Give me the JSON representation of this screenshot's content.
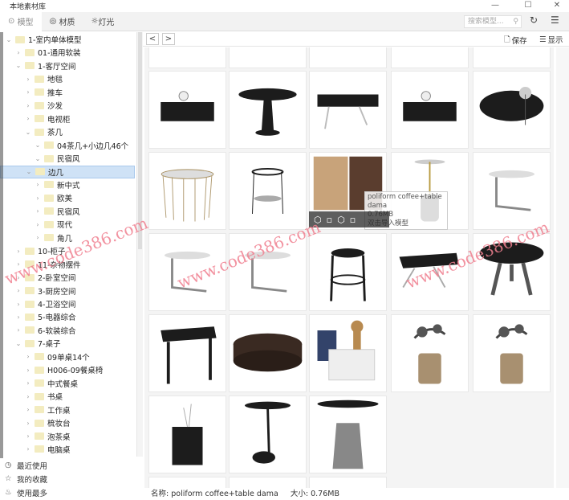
{
  "window": {
    "title": "本地素材库",
    "minimize": "—",
    "maximize": "☐",
    "close": "✕"
  },
  "tabs": [
    {
      "label": "模型",
      "icon": "cube-icon"
    },
    {
      "label": "材质",
      "icon": "palette-icon"
    },
    {
      "label": "灯光",
      "icon": "sun-icon"
    }
  ],
  "search": {
    "placeholder": "搜索模型..."
  },
  "toolbar": {
    "back": "<",
    "forward": ">",
    "save": "保存",
    "display": "显示"
  },
  "tree": [
    {
      "label": "1-室内单体模型",
      "level": 0,
      "open": true
    },
    {
      "label": "01-通用软装",
      "level": 1,
      "open": false
    },
    {
      "label": "1-客厅空间",
      "level": 1,
      "open": true
    },
    {
      "label": "地毯",
      "level": 2,
      "open": false
    },
    {
      "label": "推车",
      "level": 2,
      "open": false
    },
    {
      "label": "沙发",
      "level": 2,
      "open": false
    },
    {
      "label": "电视柜",
      "level": 2,
      "open": false
    },
    {
      "label": "茶几",
      "level": 2,
      "open": true
    },
    {
      "label": "04茶几+小边几46个",
      "level": 3,
      "open": true
    },
    {
      "label": "民宿风",
      "level": 3,
      "open": true
    },
    {
      "label": "边几",
      "level": 2,
      "open": true,
      "selected": true
    },
    {
      "label": "新中式",
      "level": 3,
      "open": false
    },
    {
      "label": "欧美",
      "level": 3,
      "open": false
    },
    {
      "label": "民宿风",
      "level": 3,
      "open": false
    },
    {
      "label": "现代",
      "level": 3,
      "open": false
    },
    {
      "label": "角几",
      "level": 3,
      "open": false
    },
    {
      "label": "10-柜子",
      "level": 1,
      "open": false
    },
    {
      "label": "11-杂物摆件",
      "level": 1,
      "open": false
    },
    {
      "label": "2-卧室空间",
      "level": 1,
      "open": false
    },
    {
      "label": "3-厨房空间",
      "level": 1,
      "open": false
    },
    {
      "label": "4-卫浴空间",
      "level": 1,
      "open": false
    },
    {
      "label": "5-电器综合",
      "level": 1,
      "open": false
    },
    {
      "label": "6-软装综合",
      "level": 1,
      "open": false
    },
    {
      "label": "7-桌子",
      "level": 1,
      "open": true
    },
    {
      "label": "09单桌14个",
      "level": 2,
      "open": false
    },
    {
      "label": "H006-09餐桌椅",
      "level": 2,
      "open": false
    },
    {
      "label": "中式餐桌",
      "level": 2,
      "open": false
    },
    {
      "label": "书桌",
      "level": 2,
      "open": false
    },
    {
      "label": "工作桌",
      "level": 2,
      "open": false
    },
    {
      "label": "梳妆台",
      "level": 2,
      "open": false
    },
    {
      "label": "泡茶桌",
      "level": 2,
      "open": false
    },
    {
      "label": "电脑桌",
      "level": 2,
      "open": false
    }
  ],
  "footer": [
    {
      "label": "最近使用",
      "icon": "clock-icon"
    },
    {
      "label": "我的收藏",
      "icon": "star-icon"
    },
    {
      "label": "使用最多",
      "icon": "fire-icon"
    }
  ],
  "tooltip": {
    "name": "poliform coffee+table dama",
    "size": "0.76MB",
    "hint": "双击导入模型"
  },
  "status": {
    "name_label": "名称:",
    "name": "poliform coffee+table dama",
    "size_label": "大小:",
    "size": "0.76MB"
  },
  "tiles": [
    "box",
    "tulip",
    "bench",
    "box",
    "pouf",
    "wire",
    "tray",
    "stool",
    "pole",
    "cside",
    "cside",
    "cside",
    "ring",
    "glass",
    "tripod",
    "square",
    "drum",
    "stools",
    "bonsai",
    "bonsai",
    "vase",
    "pole2",
    "cone"
  ],
  "watermark": "www.code386.com"
}
